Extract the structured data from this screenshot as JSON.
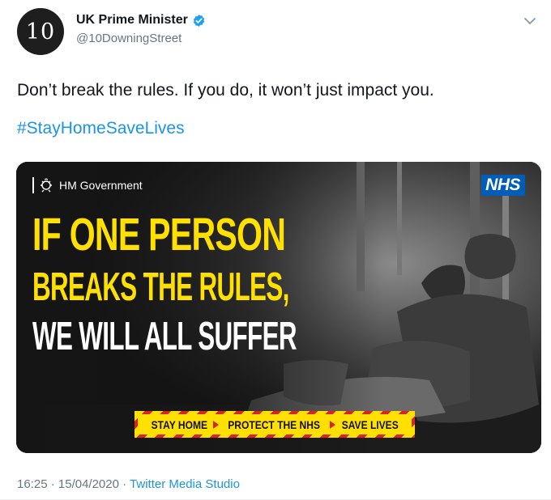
{
  "account": {
    "avatar_text": "10",
    "display_name": "UK Prime Minister",
    "handle": "@10DowningStreet",
    "verified": true
  },
  "tweet": {
    "text": "Don’t break the rules. If you do, it won’t just impact you.",
    "hashtag": "#StayHomeSaveLives"
  },
  "media": {
    "gov_label": "HM Government",
    "nhs_logo": "NHS",
    "headline_line1": "IF ONE PERSON",
    "headline_line2": "BREAKS THE RULES,",
    "headline_line3": "WE WILL ALL SUFFER",
    "banner": [
      "STAY HOME",
      "PROTECT THE NHS",
      "SAVE LIVES"
    ]
  },
  "meta": {
    "time": "16:25",
    "separator": " · ",
    "date": "15/04/2020",
    "source": "Twitter Media Studio"
  },
  "colors": {
    "link_blue": "#1b95e0",
    "headline_yellow": "#ffe000",
    "nhs_blue": "#005eb8",
    "banner_red": "#d8232a"
  },
  "icons": [
    "verified-badge-icon",
    "chevron-down-icon",
    "royal-crest-icon",
    "arrow-right-icon"
  ]
}
